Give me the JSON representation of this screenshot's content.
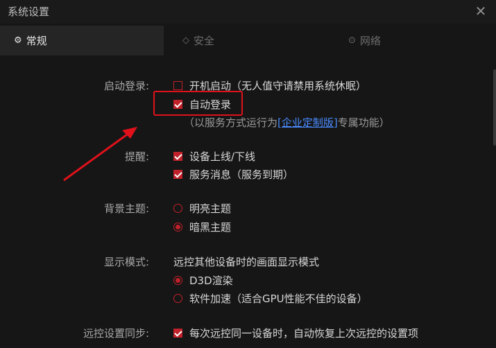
{
  "window": {
    "title": "系统设置",
    "close_glyph": "✕"
  },
  "tabs": [
    {
      "label": "常规",
      "icon": "gear-icon",
      "glyph": "⚙"
    },
    {
      "label": "安全",
      "icon": "shield-icon",
      "glyph": "◇"
    },
    {
      "label": "网络",
      "icon": "network-icon",
      "glyph": "⊙"
    }
  ],
  "sections": {
    "startup": {
      "label": "启动登录:",
      "boot_start": "开机启动（无人值守请禁用系统休眠）",
      "auto_login": "自动登录",
      "note_prefix": "（以服务方式运行为",
      "note_link": "[企业定制版]",
      "note_suffix": "专属功能）"
    },
    "reminder": {
      "label": "提醒:",
      "device_online": "设备上线/下线",
      "service_msg": "服务消息（服务到期）"
    },
    "theme": {
      "label": "背景主题:",
      "light": "明亮主题",
      "dark": "暗黑主题"
    },
    "display": {
      "label": "显示模式:",
      "desc": "远控其他设备时的画面显示模式",
      "d3d": "D3D渲染",
      "software": "软件加速（适合GPU性能不佳的设备）"
    },
    "sync": {
      "label": "远控设置同步:",
      "restore": "每次远控同一设备时，自动恢复上次远控的设置项"
    }
  },
  "colors": {
    "accent": "#c0212a",
    "highlight": "#e0111b",
    "link": "#4a8cff",
    "background": "#161616"
  }
}
